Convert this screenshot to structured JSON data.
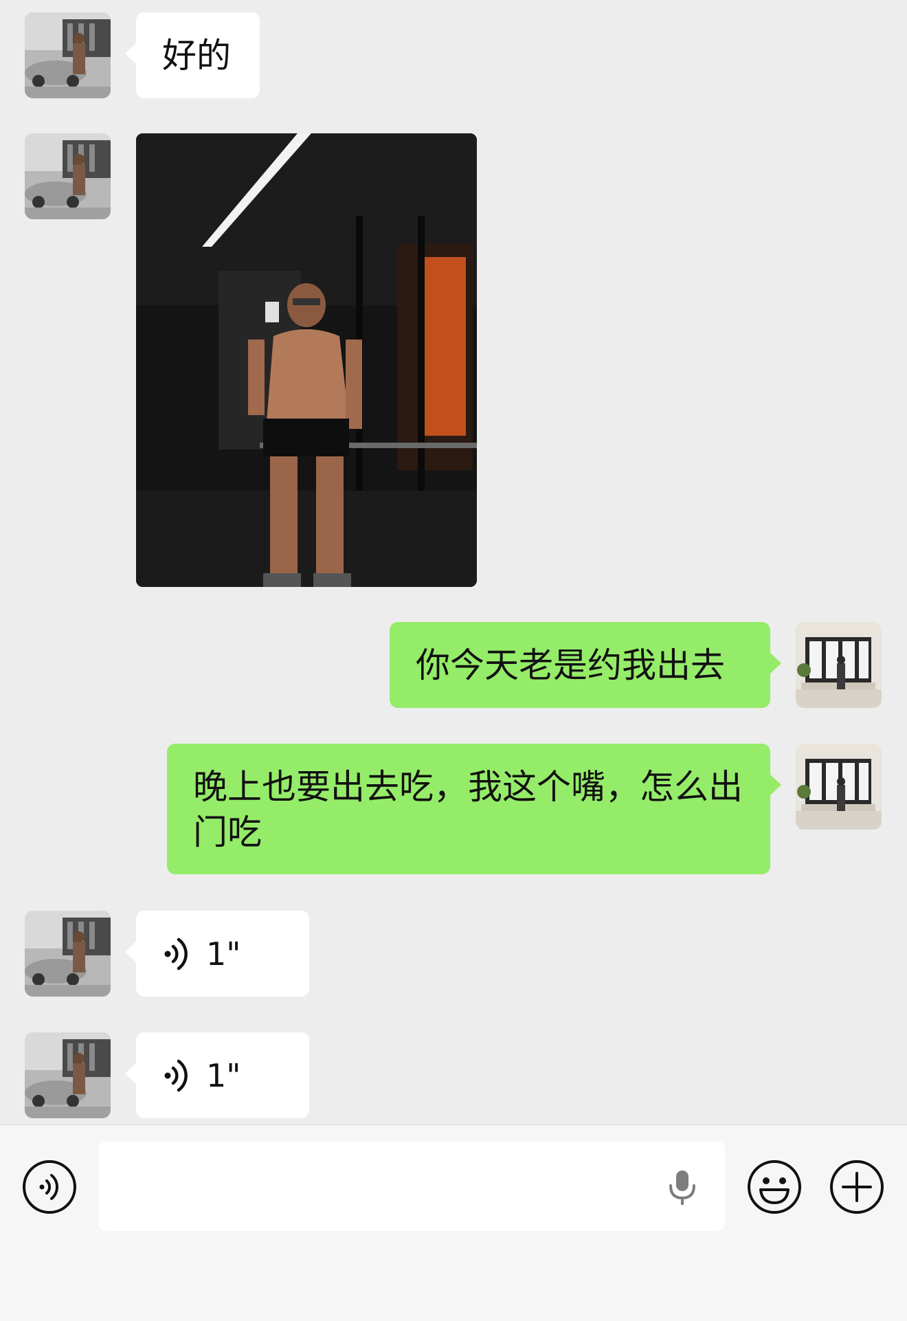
{
  "messages": [
    {
      "side": "in",
      "type": "text",
      "text": "好的"
    },
    {
      "side": "in",
      "type": "image"
    },
    {
      "side": "out",
      "type": "text",
      "text": "你今天老是约我出去"
    },
    {
      "side": "out",
      "type": "text",
      "text": "晚上也要出去吃，我这个嘴，怎么出门吃"
    },
    {
      "side": "in",
      "type": "voice",
      "duration": "1\""
    },
    {
      "side": "in",
      "type": "voice",
      "duration": "1\""
    }
  ],
  "input_bar": {
    "voice_toggle_icon": "voice-mode-icon",
    "input_value": "",
    "mic_icon": "microphone-icon",
    "emoji_icon": "emoji-icon",
    "more_icon": "plus-icon"
  },
  "colors": {
    "background": "#ededed",
    "incoming_bubble": "#ffffff",
    "outgoing_bubble": "#95ec69",
    "toolbar": "#f6f6f6"
  }
}
